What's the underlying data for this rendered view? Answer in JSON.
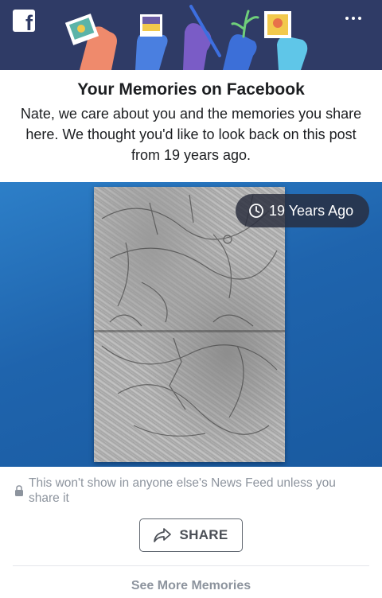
{
  "header": {
    "logo_text": "f",
    "brand_color": "#2f3b66",
    "more_icon": "more-horizontal-icon",
    "illustration": "hands-holding-photos-illustration"
  },
  "memory": {
    "title": "Your Memories on Facebook",
    "description": "Nate, we care about you and the memories you share here. We thought you'd like to look back on this post from 19 years ago.",
    "badge_label": "19 Years Ago",
    "badge_icon": "clock-icon",
    "photo_description": "pencil sketch on folded paper over blue background"
  },
  "privacy": {
    "icon": "lock-icon",
    "text": "This won't show in anyone else's News Feed unless you share it"
  },
  "actions": {
    "share_label": "SHARE",
    "share_icon": "share-arrow-icon",
    "see_more_label": "See More Memories"
  },
  "colors": {
    "text_primary": "#1c1e21",
    "text_secondary": "#8d949e",
    "photo_background": "#1f64ad"
  }
}
